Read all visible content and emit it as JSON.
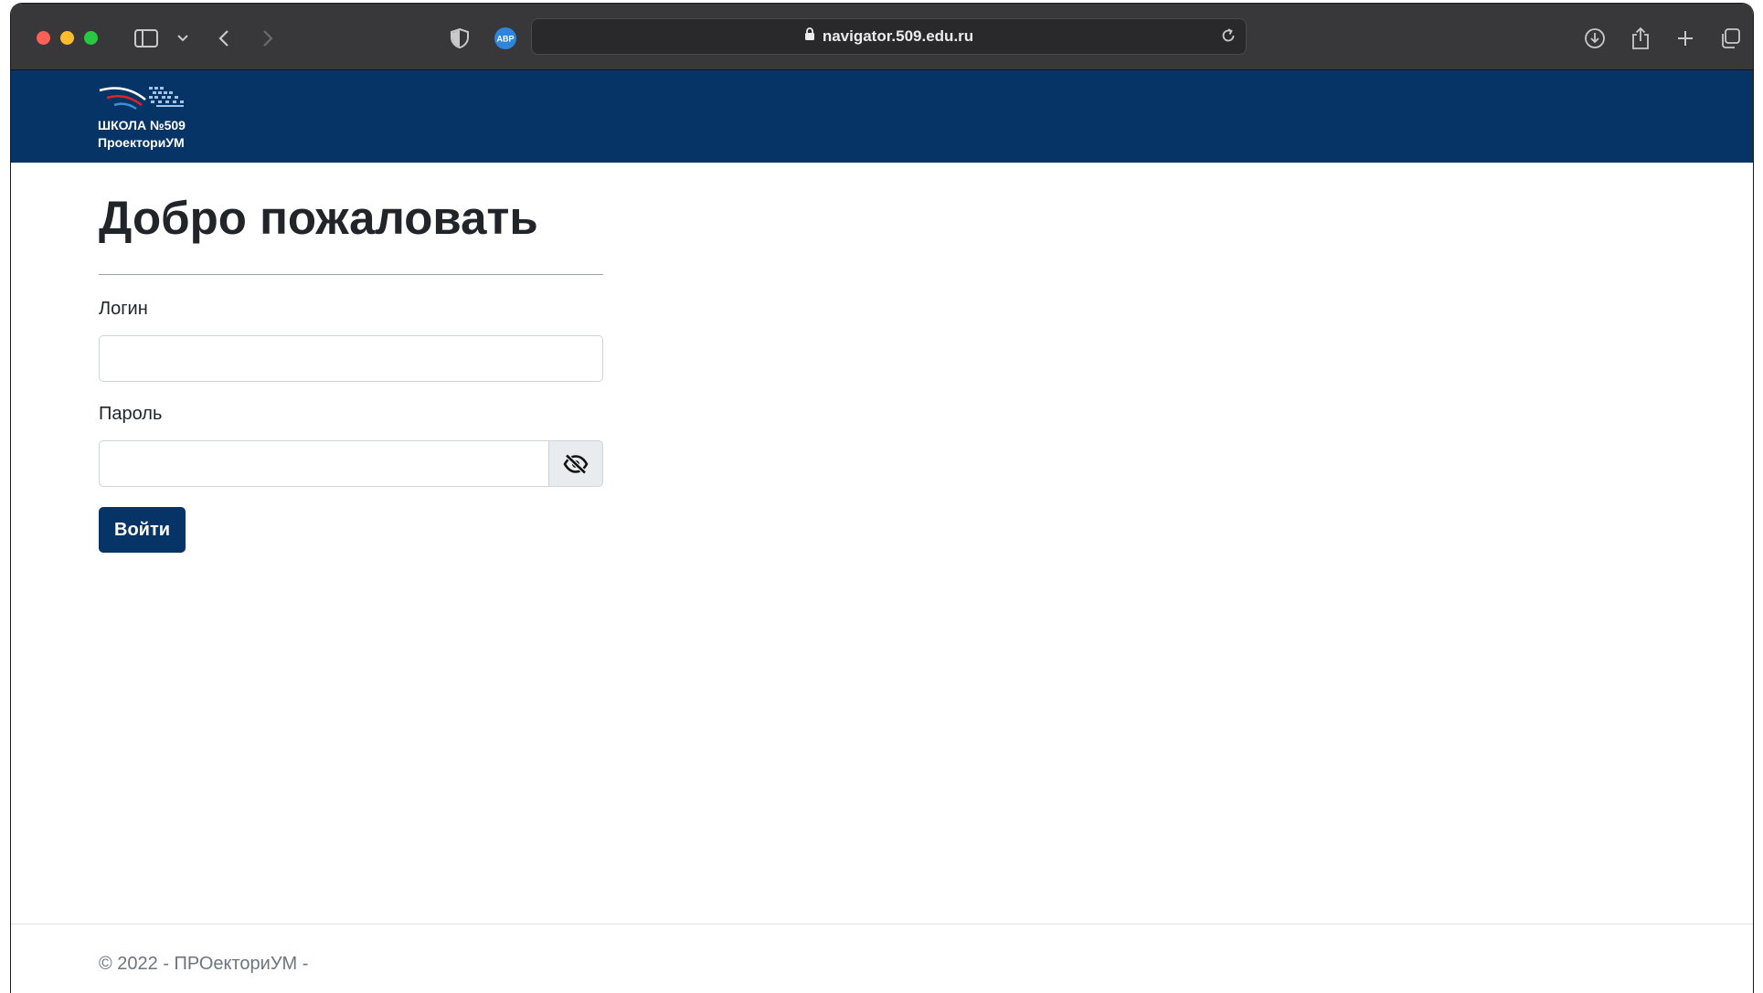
{
  "browser": {
    "url": "navigator.509.edu.ru",
    "icons": {
      "sidebar": "sidebar-toggle-icon",
      "sidebar_menu": "chevron-down-icon",
      "back": "chevron-left-icon",
      "forward": "chevron-right-icon",
      "shield": "shield-icon",
      "extension": "adblock-icon",
      "lock": "lock-icon",
      "reload": "reload-icon",
      "download": "download-icon",
      "share": "share-icon",
      "new_tab": "plus-icon",
      "tabs": "tab-overview-icon"
    },
    "extension_label": "ABP"
  },
  "header": {
    "logo_line1": "ШКОЛА №509",
    "logo_line2": "ПроекториУМ",
    "background": "#073466"
  },
  "main": {
    "title": "Добро пожаловать",
    "login_label": "Логин",
    "login_value": "",
    "password_label": "Пароль",
    "password_value": "",
    "toggle_password_icon": "eye-slash-icon",
    "submit_label": "Войти",
    "accent": "#073466"
  },
  "footer": {
    "text": "© 2022 - ПРОекториУМ -"
  }
}
